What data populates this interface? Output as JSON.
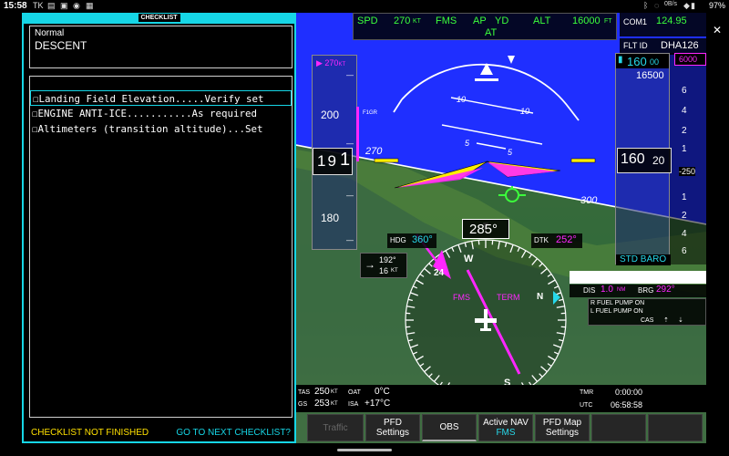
{
  "status": {
    "time": "15:58",
    "icons_left": [
      "TK",
      "app-icon",
      "screen-icon",
      "app-icon",
      "app-icon"
    ],
    "battery": "97%",
    "signal_text": "0B/s"
  },
  "checklist": {
    "title": "CHECKLIST",
    "category": "Normal",
    "phase": "DESCENT",
    "items": [
      "☐Landing Field Elevation.....Verify set",
      "☐ENGINE ANTI-ICE...........As required",
      "☐Altimeters (transition altitude)...Set"
    ],
    "footer_status": "CHECKLIST NOT FINISHED",
    "footer_next": "GO TO NEXT CHECKLIST?"
  },
  "pfd": {
    "fma": {
      "spd": "SPD",
      "spd_val": "270",
      "spd_unit": "KT",
      "fms": "FMS",
      "ap": "AP",
      "yd": "YD",
      "at": "AT",
      "alt": "ALT",
      "alt_val": "16000",
      "alt_unit": "FT"
    },
    "com1": {
      "label": "COM1",
      "freq": "124.95"
    },
    "flt_id": {
      "label": "FLT ID",
      "value": "DHA126"
    },
    "speed_tape": {
      "bug": "270",
      "bug_unit": "KT",
      "ticks": [
        "200",
        "180"
      ],
      "f1gr": "F1GR",
      "current_a": "19",
      "current_b": "1"
    },
    "alt_tape": {
      "selected": "16000",
      "selected_big": "160",
      "selected_small": "00",
      "top_label": "16500",
      "box_big": "160",
      "box_small": "20",
      "vs_ticks": [
        "6",
        "4",
        "2",
        "1",
        "1",
        "2",
        "4",
        "6"
      ],
      "vs_value": "-250",
      "baro": "STD BARO",
      "top_mag": "6000"
    },
    "pitch_labels": [
      "10",
      "10",
      "5",
      "5"
    ],
    "heading_labels": [
      "270",
      "300"
    ],
    "hsi": {
      "heading": "285°",
      "hdg_label": "HDG",
      "hdg_val": "360°",
      "dtk_label": "DTK",
      "dtk_val": "252°",
      "wind_dir": "192°",
      "wind_spd": "16",
      "wind_unit": "KT",
      "cardinals": [
        "W",
        "24",
        "S",
        "N",
        "3",
        "33"
      ],
      "fms": "FMS",
      "term": "TERM"
    },
    "dis": {
      "label": "DIS",
      "value": "1.0",
      "unit": "NM",
      "brg_label": "BRG",
      "brg_val": "292°"
    },
    "cas": {
      "msg1": "R FUEL PUMP ON",
      "msg2": "L FUEL PUMP ON",
      "label": "CAS"
    },
    "bottom": {
      "tas_label": "TAS",
      "tas_val": "250",
      "tas_unit": "KT",
      "oat_label": "OAT",
      "oat_val": "0°C",
      "gs_label": "GS",
      "gs_val": "253",
      "gs_unit": "KT",
      "isa_label": "ISA",
      "isa_val": "+17°C",
      "tmr_label": "TMR",
      "tmr_val": "0:00:00",
      "utc_label": "UTC",
      "utc_val": "06:58:58"
    },
    "softkeys": [
      {
        "l1": "Traffic",
        "l2": ""
      },
      {
        "l1": "PFD",
        "l2": "Settings"
      },
      {
        "l1": "OBS",
        "l2": ""
      },
      {
        "l1": "Active NAV",
        "l2": "FMS"
      },
      {
        "l1": "PFD Map",
        "l2": "Settings"
      }
    ]
  },
  "colors": {
    "cyan": "#16d6e6",
    "magenta": "#ff26ff",
    "yellow": "#ffe000",
    "sky": "#1f2fff",
    "green": "#3cff3c"
  }
}
